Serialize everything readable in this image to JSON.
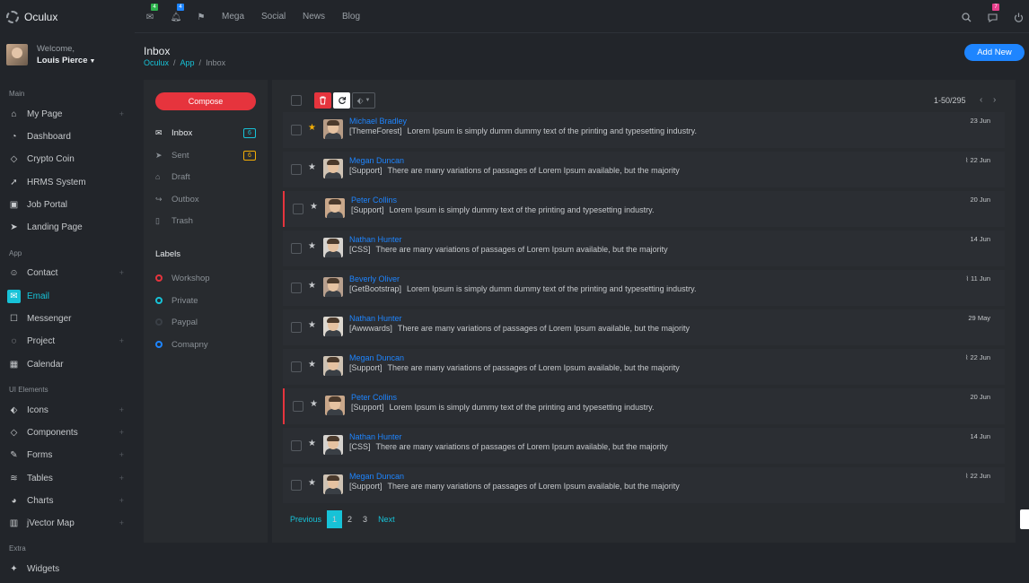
{
  "brand": {
    "name": "Oculux"
  },
  "user": {
    "welcome": "Welcome,",
    "name": "Louis Pierce"
  },
  "sidebar": {
    "sections": [
      {
        "title": "Main",
        "items": [
          {
            "label": "My Page",
            "icon": "home-icon",
            "expandable": true
          },
          {
            "label": "Dashboard",
            "icon": "speedometer-icon",
            "expandable": false
          },
          {
            "label": "Crypto Coin",
            "icon": "diamond-icon",
            "expandable": false
          },
          {
            "label": "HRMS System",
            "icon": "rocket-icon",
            "expandable": false
          },
          {
            "label": "Job Portal",
            "icon": "briefcase-icon",
            "expandable": false
          },
          {
            "label": "Landing Page",
            "icon": "send-icon",
            "expandable": false
          }
        ]
      },
      {
        "title": "App",
        "items": [
          {
            "label": "Contact",
            "icon": "users-icon",
            "expandable": true
          },
          {
            "label": "Email",
            "icon": "envelope-icon",
            "expandable": false,
            "active": true
          },
          {
            "label": "Messenger",
            "icon": "chat-icon",
            "expandable": false
          },
          {
            "label": "Project",
            "icon": "chat-bubble-icon",
            "expandable": true
          },
          {
            "label": "Calendar",
            "icon": "calendar-icon",
            "expandable": false
          }
        ]
      },
      {
        "title": "UI Elements",
        "items": [
          {
            "label": "Icons",
            "icon": "tag-icon",
            "expandable": true
          },
          {
            "label": "Components",
            "icon": "diamond-icon",
            "expandable": true
          },
          {
            "label": "Forms",
            "icon": "pencil-icon",
            "expandable": true
          },
          {
            "label": "Tables",
            "icon": "layers-icon",
            "expandable": true
          },
          {
            "label": "Charts",
            "icon": "pie-chart-icon",
            "expandable": true
          },
          {
            "label": "jVector Map",
            "icon": "map-icon",
            "expandable": true
          }
        ]
      },
      {
        "title": "Extra",
        "items": [
          {
            "label": "Widgets",
            "icon": "puzzle-icon",
            "expandable": false
          }
        ]
      }
    ]
  },
  "topbar": {
    "mail_badge": "4",
    "bell_badge": "4",
    "links": [
      "Mega",
      "Social",
      "News",
      "Blog"
    ],
    "chat_badge": "7"
  },
  "page": {
    "title": "Inbox",
    "breadcrumb": [
      "Oculux",
      "App",
      "Inbox"
    ],
    "add_new": "Add New"
  },
  "mailbox": {
    "compose": "Compose",
    "folders": [
      {
        "label": "Inbox",
        "icon": "envelope-icon",
        "count": "6",
        "count_color": "#17c2d7",
        "active": true
      },
      {
        "label": "Sent",
        "icon": "send-icon",
        "count": "6",
        "count_color": "#f3ad06"
      },
      {
        "label": "Draft",
        "icon": "home-icon",
        "count": ""
      },
      {
        "label": "Outbox",
        "icon": "share-icon",
        "count": ""
      },
      {
        "label": "Trash",
        "icon": "trash-icon",
        "count": ""
      }
    ],
    "labels_title": "Labels",
    "labels": [
      {
        "label": "Workshop",
        "color": "#e6343d"
      },
      {
        "label": "Private",
        "color": "#17c2d7"
      },
      {
        "label": "Paypal",
        "color": "#3a3f45"
      },
      {
        "label": "Comapny",
        "color": "#1e85ff"
      }
    ]
  },
  "list": {
    "pager": "1-50/295",
    "rows": [
      {
        "sender": "Michael Bradley",
        "tag": "[ThemeForest]",
        "text": "Lorem Ipsum is simply dumm dummy text of the printing and typesetting industry.",
        "date": "23 Jun",
        "starred": true,
        "attachment": false,
        "marked": false
      },
      {
        "sender": "Megan Duncan",
        "tag": "[Support]",
        "text": "There are many variations of passages of Lorem Ipsum available, but the majority",
        "date": "22 Jun",
        "starred": false,
        "attachment": true,
        "marked": false
      },
      {
        "sender": "Peter Collins",
        "tag": "[Support]",
        "text": "Lorem Ipsum is simply dummy text of the printing and typesetting industry.",
        "date": "20 Jun",
        "starred": false,
        "attachment": false,
        "marked": true
      },
      {
        "sender": "Nathan Hunter",
        "tag": "[CSS]",
        "text": "There are many variations of passages of Lorem Ipsum available, but the majority",
        "date": "14 Jun",
        "starred": false,
        "attachment": false,
        "marked": false
      },
      {
        "sender": "Beverly Oliver",
        "tag": "[GetBootstrap]",
        "text": "Lorem Ipsum is simply dumm dummy text of the printing and typesetting industry.",
        "date": "11 Jun",
        "starred": false,
        "attachment": true,
        "marked": false
      },
      {
        "sender": "Nathan Hunter",
        "tag": "[Awwwards]",
        "text": "There are many variations of passages of Lorem Ipsum available, but the majority",
        "date": "29 May",
        "starred": false,
        "attachment": false,
        "marked": false
      },
      {
        "sender": "Megan Duncan",
        "tag": "[Support]",
        "text": "There are many variations of passages of Lorem Ipsum available, but the majority",
        "date": "22 Jun",
        "starred": false,
        "attachment": true,
        "marked": false
      },
      {
        "sender": "Peter Collins",
        "tag": "[Support]",
        "text": "Lorem Ipsum is simply dummy text of the printing and typesetting industry.",
        "date": "20 Jun",
        "starred": false,
        "attachment": false,
        "marked": true
      },
      {
        "sender": "Nathan Hunter",
        "tag": "[CSS]",
        "text": "There are many variations of passages of Lorem Ipsum available, but the majority",
        "date": "14 Jun",
        "starred": false,
        "attachment": false,
        "marked": false
      },
      {
        "sender": "Megan Duncan",
        "tag": "[Support]",
        "text": "There are many variations of passages of Lorem Ipsum available, but the majority",
        "date": "22 Jun",
        "starred": false,
        "attachment": true,
        "marked": false
      }
    ],
    "pagination": {
      "previous": "Previous",
      "pages": [
        "1",
        "2",
        "3"
      ],
      "current": "1",
      "next": "Next"
    }
  },
  "colors": {
    "accent": "#17c2d7",
    "primary": "#1e85ff",
    "danger": "#e6343d",
    "warning": "#f3ad06"
  }
}
